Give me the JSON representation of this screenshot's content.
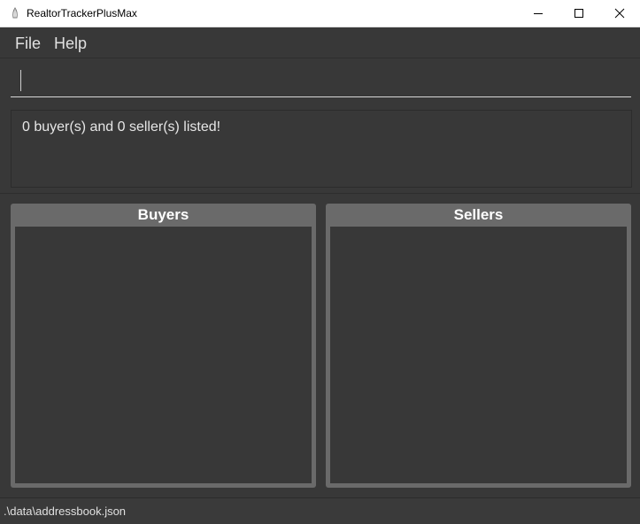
{
  "window": {
    "title": "RealtorTrackerPlusMax"
  },
  "menu": {
    "file_label": "File",
    "help_label": "Help"
  },
  "command": {
    "value": "",
    "placeholder": ""
  },
  "result": {
    "message": "0 buyer(s) and 0 seller(s) listed!"
  },
  "buyers_panel": {
    "title": "Buyers",
    "items": []
  },
  "sellers_panel": {
    "title": "Sellers",
    "items": []
  },
  "status": {
    "file_path": ".\\data\\addressbook.json"
  },
  "colors": {
    "background": "#383838",
    "panel_header": "#6a6a6a",
    "text": "#e0e0e0"
  },
  "icons": {
    "app": "app-icon",
    "minimize": "minimize-icon",
    "maximize": "maximize-icon",
    "close": "close-icon"
  }
}
